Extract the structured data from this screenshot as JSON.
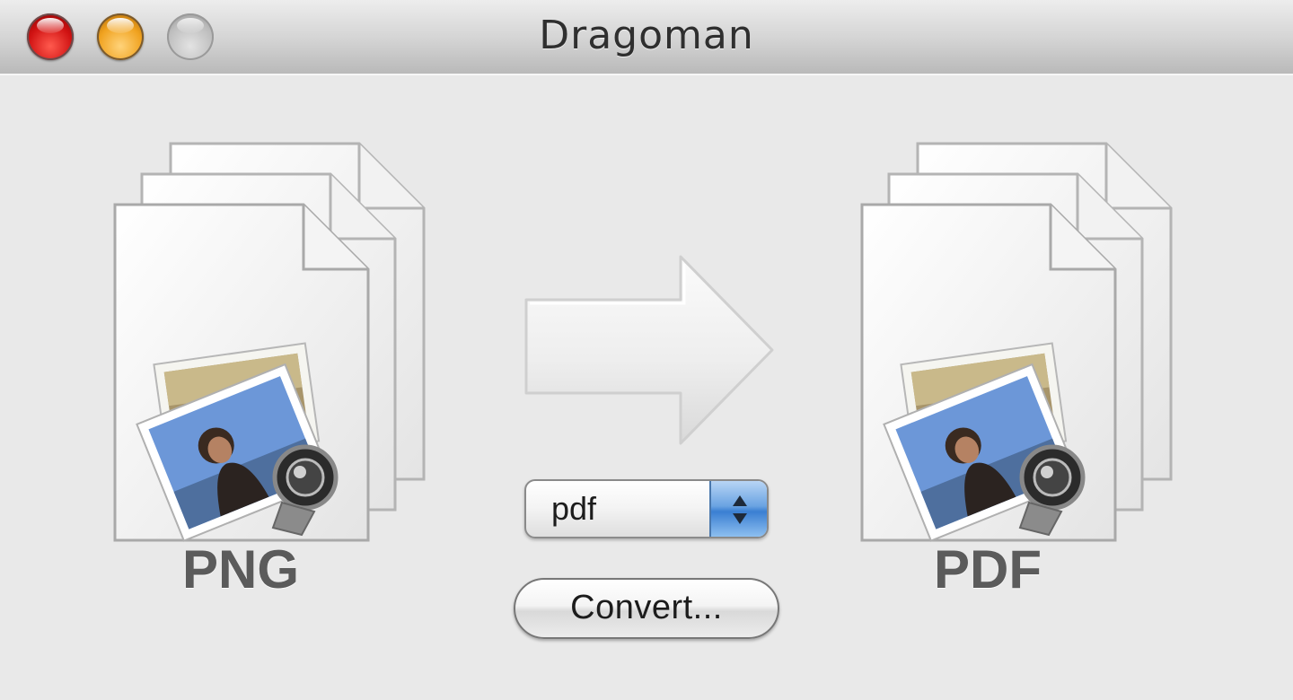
{
  "window": {
    "title": "Dragoman"
  },
  "title_bar": {
    "buttons": [
      "close",
      "minimize",
      "zoom"
    ]
  },
  "source": {
    "label": "PNG",
    "icon": "png-document-stack-icon"
  },
  "target": {
    "label": "PDF",
    "icon": "pdf-document-stack-icon"
  },
  "format_popup": {
    "selected": "pdf"
  },
  "convert_button": {
    "label": "Convert..."
  },
  "colors": {
    "close": "#d01212",
    "minimize": "#f0a21f",
    "zoom": "#bdbdbd",
    "popup_accent": "#3a7fd2",
    "label_text": "#5b5b5b"
  }
}
